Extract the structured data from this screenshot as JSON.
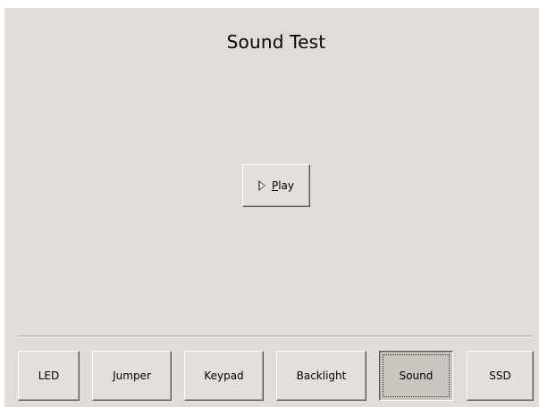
{
  "window": {
    "title": "Sound Test"
  },
  "play_button": {
    "mnemonic": "P",
    "label_rest": "lay",
    "icon": "play-triangle-icon"
  },
  "tabs": [
    {
      "label": "LED",
      "active": false
    },
    {
      "label": "Jumper",
      "active": false
    },
    {
      "label": "Keypad",
      "active": false
    },
    {
      "label": "Backlight",
      "active": false
    },
    {
      "label": "Sound",
      "active": true
    },
    {
      "label": "SSD",
      "active": false
    }
  ],
  "colors": {
    "background": "#e0ddd8",
    "button_face": "#e3e0db",
    "active_button_face": "#c9c5bf"
  }
}
